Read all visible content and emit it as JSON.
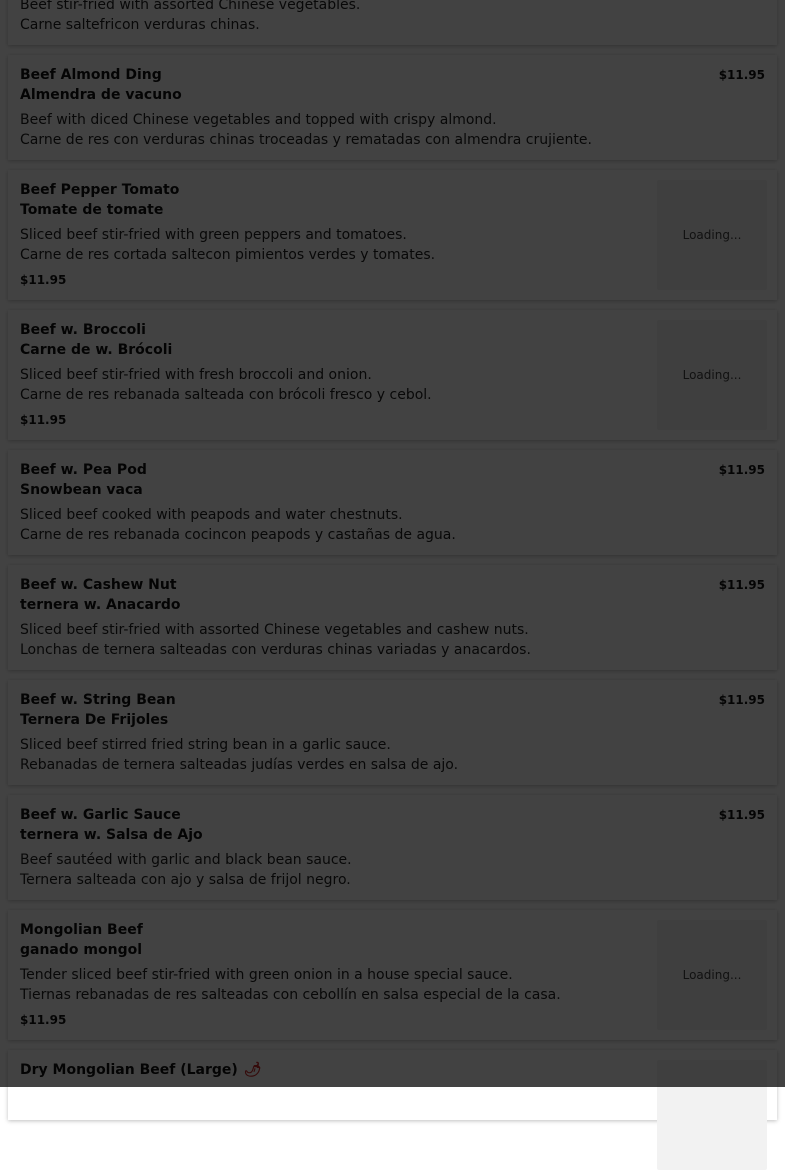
{
  "top_partial": {
    "desc_en": "Beef stir-fried with assorted Chinese vegetables.",
    "desc_es": "Carne saltefricon verduras chinas."
  },
  "loading_text": "Loading...",
  "items": [
    {
      "name_en": "Beef Almond Ding",
      "name_es": "Almendra de vacuno",
      "desc_en": "Beef with diced Chinese vegetables and topped with crispy almond.",
      "desc_es": "Carne de res con verduras chinas troceadas y rematadas con almendra crujiente.",
      "price": "$11.95"
    },
    {
      "name_en": "Beef Pepper Tomato",
      "name_es": "Tomate de tomate",
      "desc_en": "Sliced beef stir-fried with green peppers and tomatoes.",
      "desc_es": "Carne de res cortada saltecon pimientos verdes y tomates.",
      "price": "$11.95"
    },
    {
      "name_en": "Beef w. Broccoli",
      "name_es": "Carne de w. Brócoli",
      "desc_en": "Sliced beef stir-fried with fresh broccoli and onion.",
      "desc_es": "Carne de res rebanada salteada con brócoli fresco y cebol.",
      "price": "$11.95"
    },
    {
      "name_en": "Beef w. Pea Pod",
      "name_es": "Snowbean vaca",
      "desc_en": "Sliced beef cooked with peapods and water chestnuts.",
      "desc_es": "Carne de res rebanada cocincon peapods y castañas de agua.",
      "price": "$11.95"
    },
    {
      "name_en": "Beef w. Cashew Nut",
      "name_es": "ternera w. Anacardo",
      "desc_en": "Sliced beef stir-fried with assorted Chinese vegetables and cashew nuts.",
      "desc_es": "Lonchas de ternera salteadas con verduras chinas variadas y anacardos.",
      "price": "$11.95"
    },
    {
      "name_en": "Beef w. String Bean",
      "name_es": "Ternera De Frijoles",
      "desc_en": "Sliced beef stirred fried string bean in a garlic sauce.",
      "desc_es": "Rebanadas de ternera salteadas judías verdes en salsa de ajo.",
      "price": "$11.95"
    },
    {
      "name_en": "Beef w. Garlic Sauce",
      "name_es": "ternera w. Salsa de Ajo",
      "desc_en": "Beef sautéed with garlic and black bean sauce.",
      "desc_es": "Ternera salteada con ajo y salsa de frijol negro.",
      "price": "$11.95"
    },
    {
      "name_en": "Mongolian Beef",
      "name_es": "ganado mongol",
      "desc_en": "Tender sliced beef stir-fried with green onion in a house special sauce.",
      "desc_es": "Tiernas rebanadas de res salteadas con cebollín en salsa especial de la casa.",
      "price": "$11.95"
    },
    {
      "name_en": "Dry Mongolian Beef (Large)",
      "spicy_icon": "chili-pepper-icon"
    }
  ]
}
